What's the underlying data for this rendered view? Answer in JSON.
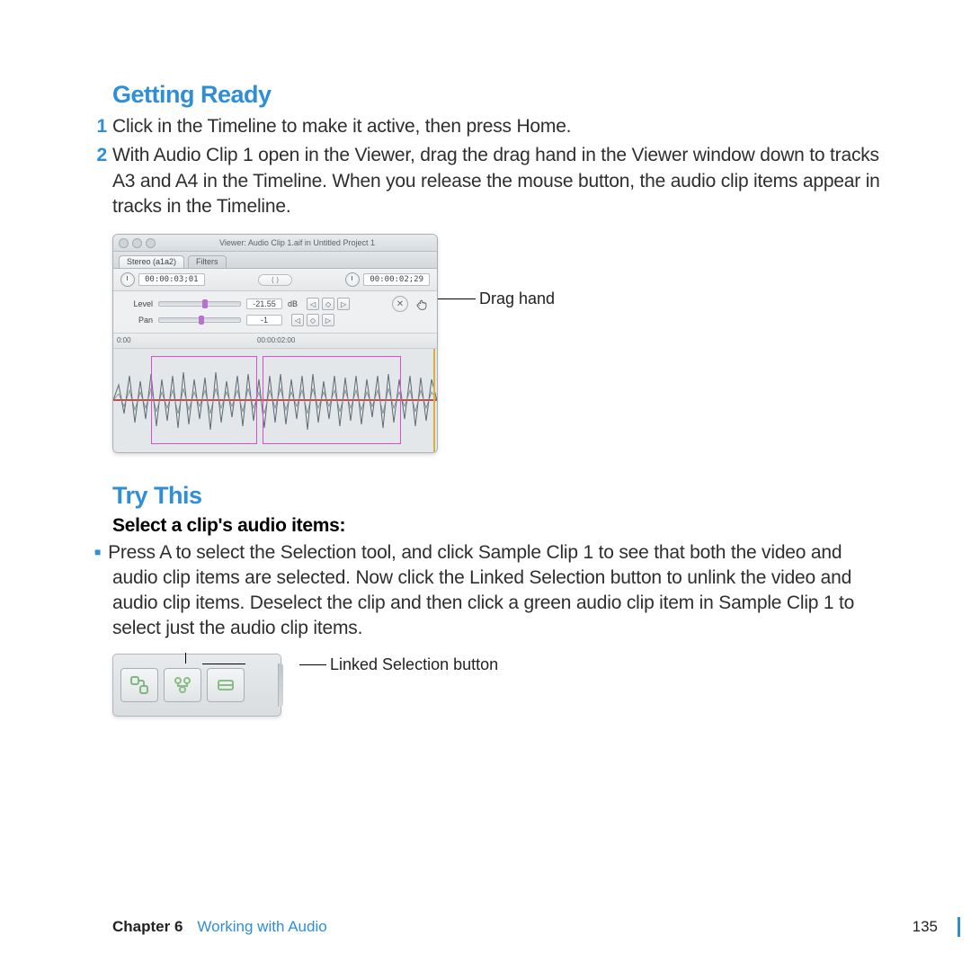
{
  "sections": {
    "getting_ready": {
      "heading": "Getting Ready",
      "steps": [
        "Click in the Timeline to make it active, then press Home.",
        "With Audio Clip 1 open in the Viewer, drag the drag hand in the Viewer window down to tracks A3 and A4 in the Timeline. When you release the mouse button, the audio clip items appear in tracks in the Timeline."
      ]
    },
    "try_this": {
      "heading": "Try This",
      "subheading": "Select a clip's audio items:",
      "bullets": [
        "Press A to select the Selection tool, and click Sample Clip 1 to see that both the video and audio clip items are selected. Now click the Linked Selection button to unlink the video and audio clip items. Deselect the clip and then click a green audio clip item in Sample Clip 1 to select just the audio clip items."
      ]
    }
  },
  "viewer": {
    "window_title": "Viewer: Audio Clip 1.aif in Untitled Project 1",
    "tabs": {
      "active": "Stereo (a1a2)",
      "inactive": "Filters"
    },
    "tc_left": "00:00:03;01",
    "tc_right": "00:00:02;29",
    "level_label": "Level",
    "level_value": "-21.55",
    "level_unit": "dB",
    "pan_label": "Pan",
    "pan_value": "-1",
    "ruler_left": "0:00",
    "ruler_mid": "00:00:02:00",
    "callout": "Drag hand"
  },
  "toolbar": {
    "callout": "Linked Selection button"
  },
  "footer": {
    "chapter_label": "Chapter 6",
    "chapter_title": "Working with Audio",
    "page_number": "135"
  }
}
